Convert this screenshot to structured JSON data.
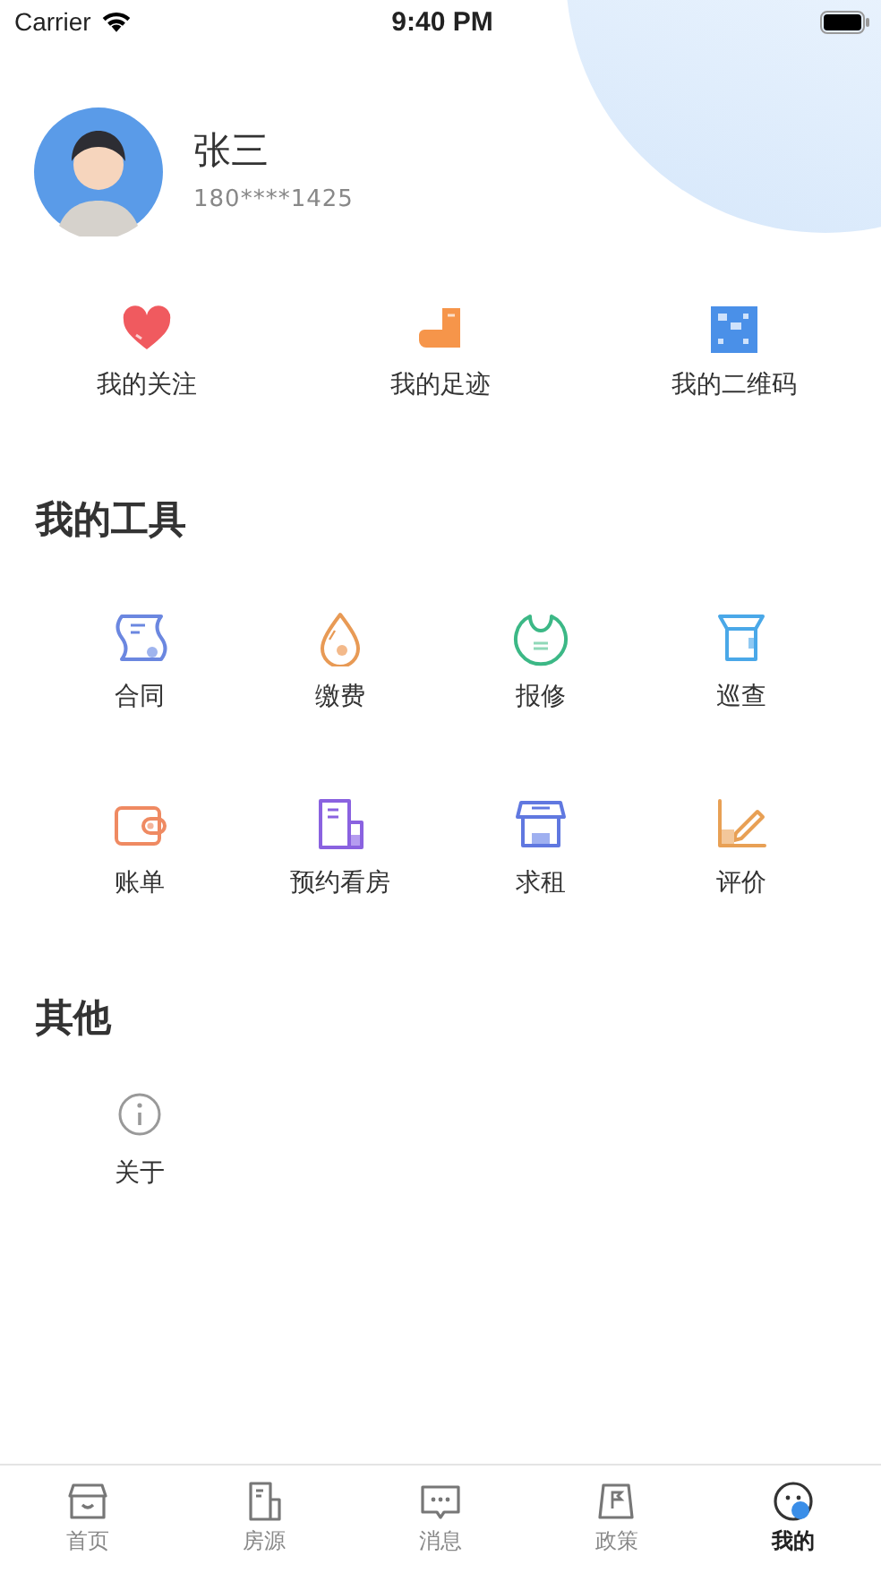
{
  "status_bar": {
    "carrier": "Carrier",
    "time": "9:40 PM"
  },
  "profile": {
    "name": "张三",
    "phone": "180****1425"
  },
  "shortcuts": [
    {
      "label": "我的关注"
    },
    {
      "label": "我的足迹"
    },
    {
      "label": "我的二维码"
    }
  ],
  "tools": {
    "title": "我的工具",
    "items": [
      {
        "label": "合同"
      },
      {
        "label": "缴费"
      },
      {
        "label": "报修"
      },
      {
        "label": "巡查"
      },
      {
        "label": "账单"
      },
      {
        "label": "预约看房"
      },
      {
        "label": "求租"
      },
      {
        "label": "评价"
      }
    ]
  },
  "other": {
    "title": "其他",
    "items": [
      {
        "label": "关于"
      }
    ]
  },
  "tab_bar": [
    {
      "label": "首页",
      "selected": false
    },
    {
      "label": "房源",
      "selected": false
    },
    {
      "label": "消息",
      "selected": false
    },
    {
      "label": "政策",
      "selected": false
    },
    {
      "label": "我的",
      "selected": true
    }
  ]
}
